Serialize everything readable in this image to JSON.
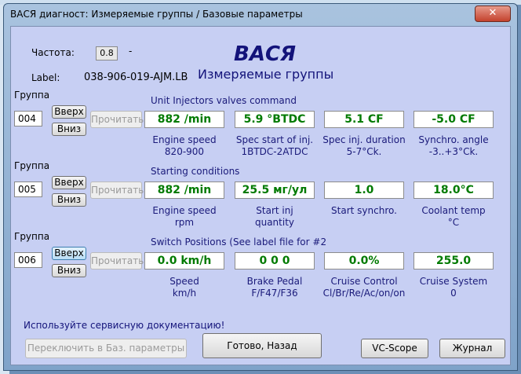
{
  "window": {
    "title": "ВАСЯ диагност: Измеряемые группы / Базовые параметры",
    "close": "✕"
  },
  "header": {
    "freq_label": "Частота:",
    "freq_value": "0.8",
    "freq_dash": "-",
    "label_label": "Label:",
    "label_value": "038-906-019-AJM.LB",
    "brand": "ВАСЯ",
    "subtitle": "Измеряемые группы"
  },
  "groups": [
    {
      "group_label": "Группа",
      "number": "004",
      "up": "Вверх",
      "down": "Вниз",
      "read": "Прочитать",
      "title": "Unit Injectors valves command",
      "cells": [
        {
          "value": "882 /min",
          "cap1": "Engine speed",
          "cap2": "820-900"
        },
        {
          "value": "5.9 °BTDC",
          "cap1": "Spec start of inj.",
          "cap2": "1BTDC-2ATDC"
        },
        {
          "value": "5.1 CF",
          "cap1": "Spec inj. duration",
          "cap2": "5-7°Ck."
        },
        {
          "value": "-5.0 CF",
          "cap1": "Synchro. angle",
          "cap2": "-3..+3°Ck."
        }
      ]
    },
    {
      "group_label": "Группа",
      "number": "005",
      "up": "Вверх",
      "down": "Вниз",
      "read": "Прочитать",
      "title": "Starting conditions",
      "cells": [
        {
          "value": "882 /min",
          "cap1": "Engine speed",
          "cap2": "rpm"
        },
        {
          "value": "25.5 мг/ул",
          "cap1": "Start inj",
          "cap2": "quantity"
        },
        {
          "value": "1.0",
          "cap1": "Start synchro.",
          "cap2": ""
        },
        {
          "value": "18.0°C",
          "cap1": "Coolant temp",
          "cap2": "°C"
        }
      ]
    },
    {
      "group_label": "Группа",
      "number": "006",
      "up": "Вверх",
      "down": "Вниз",
      "read": "Прочитать",
      "title": "Switch Positions (See label file for #2",
      "cells": [
        {
          "value": "0.0 km/h",
          "cap1": "Speed",
          "cap2": "km/h"
        },
        {
          "value": "0  0  0",
          "cap1": "Brake Pedal",
          "cap2": "F/F47/F36"
        },
        {
          "value": "0.0%",
          "cap1": "Cruise Control",
          "cap2": "Cl/Br/Re/Ac/on/on"
        },
        {
          "value": "255.0",
          "cap1": "Cruise System",
          "cap2": "0"
        }
      ]
    }
  ],
  "footer": {
    "service_note": "Используйте сервисную документацию!",
    "switch_basic": "Переключить в Баз. параметры",
    "done_back": "Готово, Назад",
    "vcscope": "VC-Scope",
    "journal": "Журнал"
  },
  "colors": {
    "value_green": "#007a00",
    "navy_text": "#1a1a7a",
    "client_bg": "#c7cff3"
  }
}
